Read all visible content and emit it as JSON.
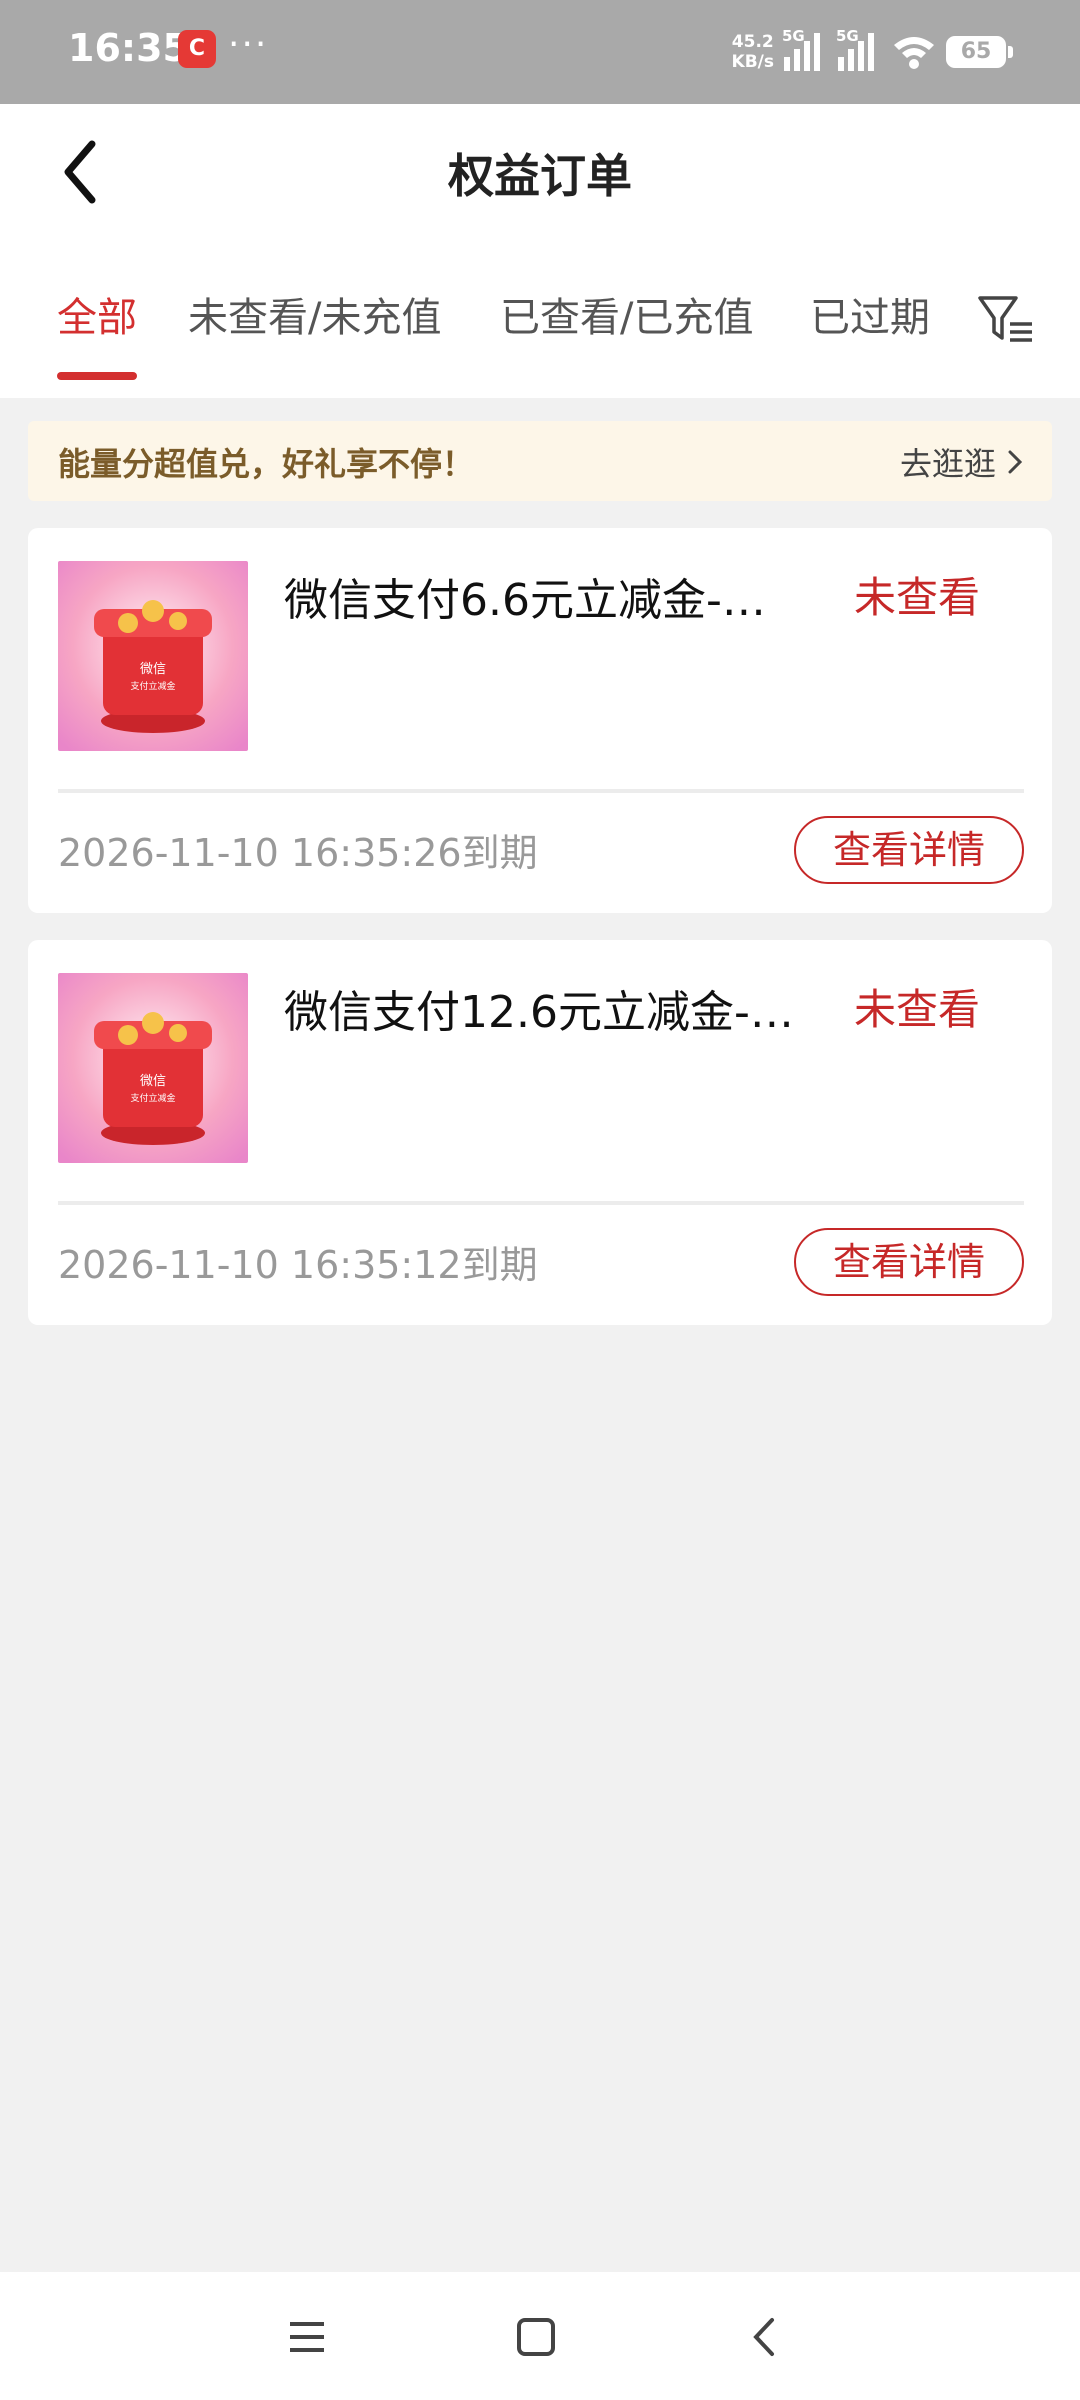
{
  "status_bar": {
    "time": "16:35",
    "app_icon_text": "C",
    "dots": "···",
    "net_speed_value": "45.2",
    "net_speed_unit": "KB/s",
    "sim1_label": "5G",
    "sim2_label": "5G",
    "battery": "65"
  },
  "header": {
    "title": "权益订单",
    "back_icon": "chevron-left-icon"
  },
  "tabs": [
    {
      "label": "全部",
      "active": true
    },
    {
      "label": "未查看/未充值",
      "active": false
    },
    {
      "label": "已查看/已充值",
      "active": false
    },
    {
      "label": "已过期",
      "active": false
    }
  ],
  "filter_icon": "filter-icon",
  "banner": {
    "text": "能量分超值兑，好礼享不停！",
    "link": "去逛逛"
  },
  "orders": [
    {
      "title": "微信支付6.6元立减金-…",
      "status": "未查看",
      "expire": "2026-11-10 16:35:26到期",
      "button": "查看详情",
      "thumb_line1": "微信",
      "thumb_line2": "支付立减金"
    },
    {
      "title": "微信支付12.6元立减金-…",
      "status": "未查看",
      "expire": "2026-11-10 16:35:12到期",
      "button": "查看详情",
      "thumb_line1": "微信",
      "thumb_line2": "支付立减金"
    }
  ],
  "colors": {
    "accent": "#d32f2f",
    "banner_bg": "#fdf6e8",
    "banner_text": "#7b5c2a",
    "status_bar": "#a9a9a9"
  },
  "nav_bar": {
    "icons": [
      "menu-icon",
      "home-square-icon",
      "back-icon"
    ]
  }
}
